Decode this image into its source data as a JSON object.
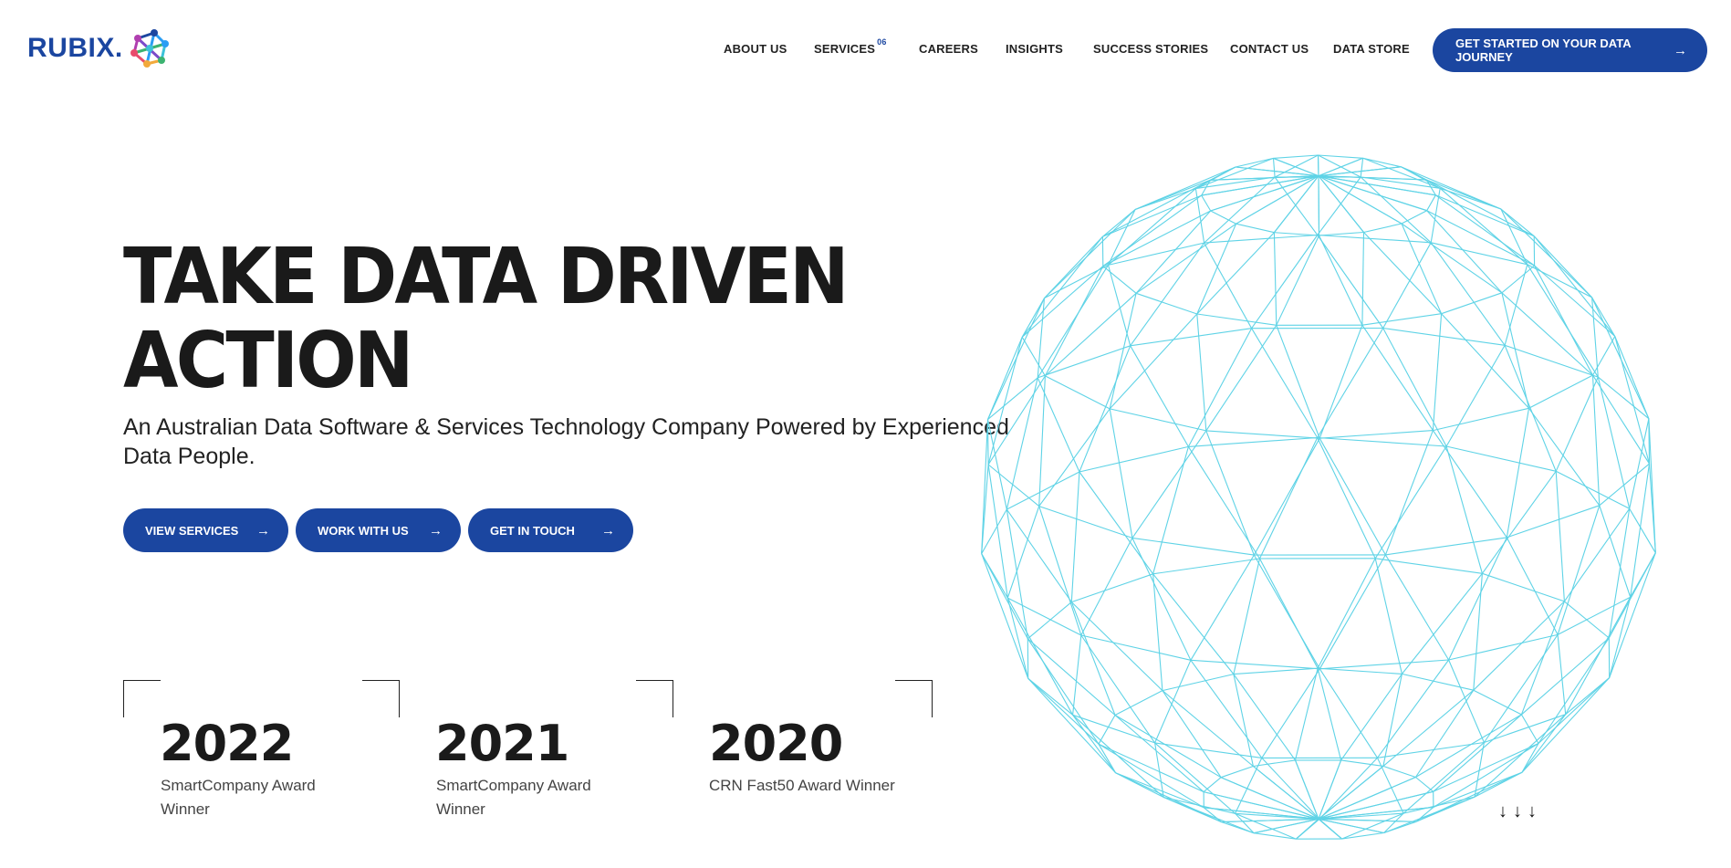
{
  "logo": {
    "text": "RUBIX."
  },
  "nav": {
    "items": [
      {
        "label": "ABOUT US"
      },
      {
        "label": "SERVICES",
        "badge": "06"
      },
      {
        "label": "CAREERS"
      },
      {
        "label": "INSIGHTS"
      },
      {
        "label": "SUCCESS STORIES"
      },
      {
        "label": "CONTACT US"
      },
      {
        "label": "DATA STORE"
      }
    ],
    "cta_label": "GET STARTED ON YOUR DATA JOURNEY"
  },
  "hero": {
    "title_line1": "TAKE DATA DRIVEN",
    "title_line2": "ACTION",
    "subtitle": "An Australian Data Software & Services Technology Company Powered by Experienced Data People.",
    "buttons": [
      {
        "label": "VIEW SERVICES"
      },
      {
        "label": "WORK WITH US"
      },
      {
        "label": "GET IN TOUCH"
      }
    ]
  },
  "awards": [
    {
      "year": "2022",
      "text": "SmartCompany Award Winner"
    },
    {
      "year": "2021",
      "text": "SmartCompany Award Winner"
    },
    {
      "year": "2020",
      "text": "CRN Fast50 Award Winner"
    }
  ],
  "icons": {
    "arrow": "→",
    "scroll": "↓"
  },
  "colors": {
    "brand_blue": "#1b46a0",
    "globe_line": "#5fd3e6",
    "text_dark": "#1a1a1a"
  }
}
